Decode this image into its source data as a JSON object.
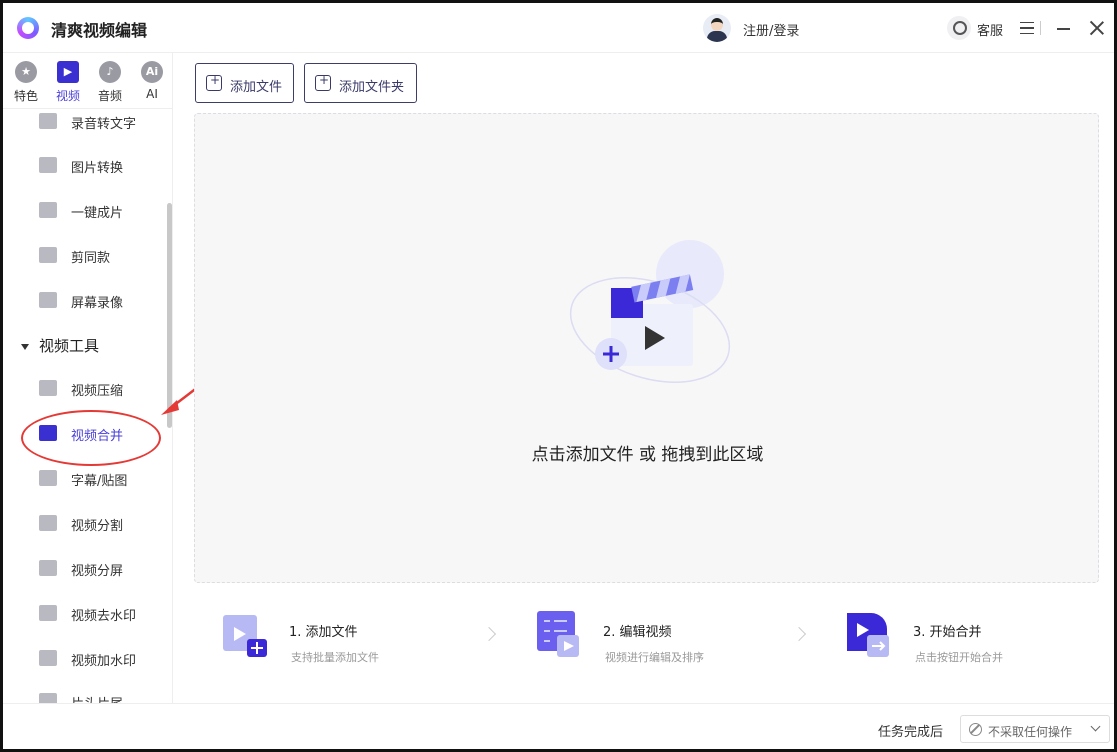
{
  "app": {
    "title": "清爽视频编辑",
    "login": "注册/登录",
    "service": "客服"
  },
  "categories": [
    {
      "label": "特色",
      "glyph": "★",
      "active": false
    },
    {
      "label": "视频",
      "glyph": "▶",
      "active": true
    },
    {
      "label": "音频",
      "glyph": "♪",
      "active": false
    },
    {
      "label": "AI",
      "glyph": "Ai",
      "active": false
    }
  ],
  "sidebar": {
    "items_top": [
      {
        "label": "录音转文字"
      },
      {
        "label": "图片转换"
      },
      {
        "label": "一键成片"
      },
      {
        "label": "剪同款"
      },
      {
        "label": "屏幕录像"
      }
    ],
    "section": "视频工具",
    "items_tools": [
      {
        "label": "视频压缩",
        "active": false
      },
      {
        "label": "视频合并",
        "active": true
      },
      {
        "label": "字幕/贴图",
        "active": false
      },
      {
        "label": "视频分割",
        "active": false
      },
      {
        "label": "视频分屏",
        "active": false
      },
      {
        "label": "视频去水印",
        "active": false
      },
      {
        "label": "视频加水印",
        "active": false
      },
      {
        "label": "片头片尾",
        "active": false
      }
    ]
  },
  "toolbar": {
    "add_file": "添加文件",
    "add_folder": "添加文件夹"
  },
  "dropzone": {
    "hint": "点击添加文件 或 拖拽到此区域"
  },
  "steps": [
    {
      "title": "1. 添加文件",
      "desc": "支持批量添加文件"
    },
    {
      "title": "2. 编辑视频",
      "desc": "视频进行编辑及排序"
    },
    {
      "title": "3. 开始合并",
      "desc": "点击按钮开始合并"
    }
  ],
  "status": {
    "after_label": "任务完成后",
    "after_value": "不采取任何操作"
  },
  "colors": {
    "accent": "#3a2fd0",
    "annotation": "#e53935"
  }
}
